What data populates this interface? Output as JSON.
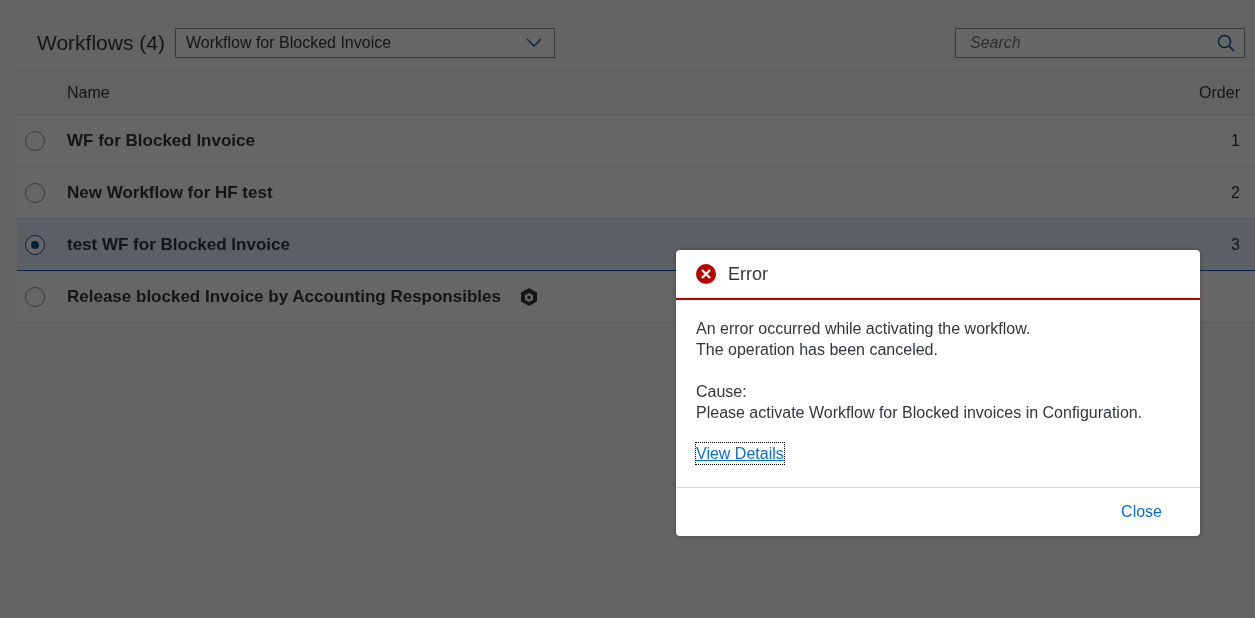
{
  "header": {
    "title": "Workflows (4)",
    "select": {
      "value": "Workflow for Blocked Invoice"
    },
    "search": {
      "placeholder": "Search"
    }
  },
  "table": {
    "columns": [
      "Name",
      "Order"
    ],
    "rows": [
      {
        "name": "WF for Blocked Invoice",
        "order": "1",
        "selected": false,
        "has_icon": false
      },
      {
        "name": "New Workflow for HF test",
        "order": "2",
        "selected": false,
        "has_icon": false
      },
      {
        "name": "test WF for Blocked Invoice",
        "order": "3",
        "selected": true,
        "has_icon": false
      },
      {
        "name": "Release blocked Invoice by Accounting Responsibles",
        "selected": false,
        "has_icon": true
      }
    ]
  },
  "dialog": {
    "kind": "error",
    "title": "Error",
    "message": [
      "An error occurred while activating the workflow.",
      "The operation has been canceled."
    ],
    "cause_label": "Cause:",
    "cause": "Please activate Workflow for Blocked invoices in Configuration.",
    "link": "View Details",
    "button": "Close"
  }
}
